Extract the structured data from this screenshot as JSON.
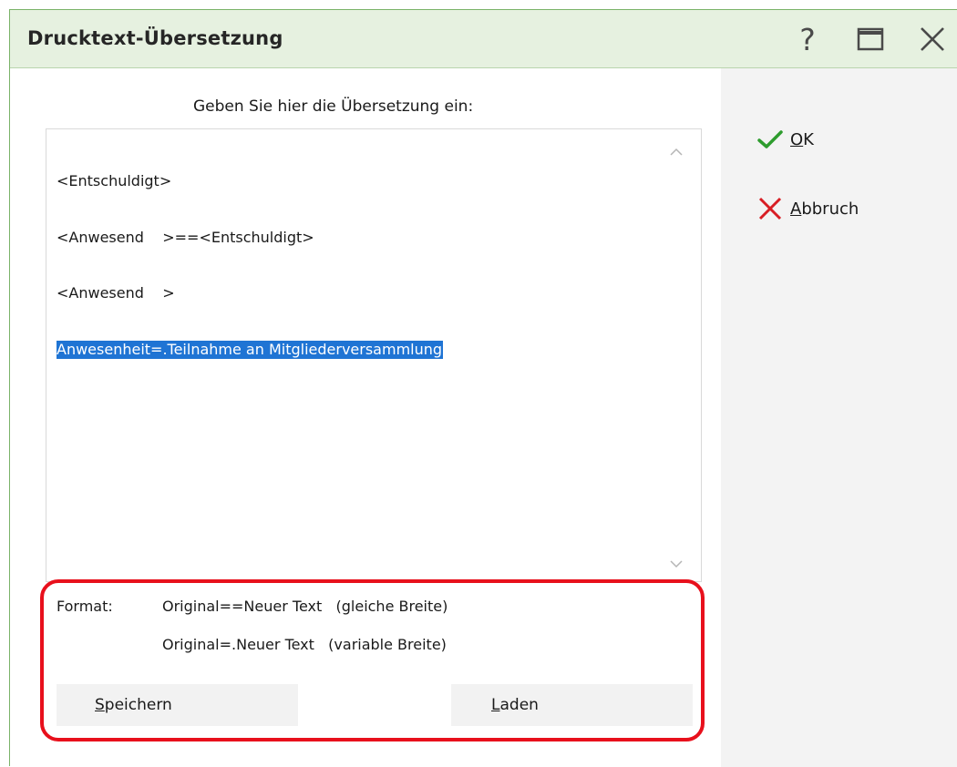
{
  "window": {
    "title": "Drucktext-Übersetzung",
    "help_glyph": "?"
  },
  "main": {
    "prompt": "Geben Sie hier die Übersetzung ein:",
    "lines": [
      "<Entschuldigt>",
      "<Anwesend    >==<Entschuldigt>",
      "<Anwesend    >",
      "Anwesenheit=.Teilnahme an Mitgliederversammlung"
    ],
    "selected_line_index": 3
  },
  "format": {
    "label": "Format:",
    "example1": "Original==Neuer Text   (gleiche Breite)",
    "example2": "Original=.Neuer Text   (variable Breite)"
  },
  "buttons": {
    "save_prefix": "S",
    "save_rest": "peichern",
    "load_prefix": "L",
    "load_rest": "aden"
  },
  "side": {
    "ok_prefix": "O",
    "ok_rest": "K",
    "cancel_prefix": "A",
    "cancel_rest": "bbruch"
  },
  "colors": {
    "titlebar_bg": "#e6f1e0",
    "window_border": "#7ab368",
    "selection": "#1f74d4",
    "highlight": "#e8101c",
    "ok_check": "#2e9c2e",
    "cancel_x": "#d81e24"
  },
  "icons": {
    "help": "question-mark",
    "maximize": "maximize-window",
    "close": "close-x",
    "ok": "check-mark",
    "cancel": "red-x",
    "scroll_up": "chevron-up",
    "scroll_down": "chevron-down"
  }
}
